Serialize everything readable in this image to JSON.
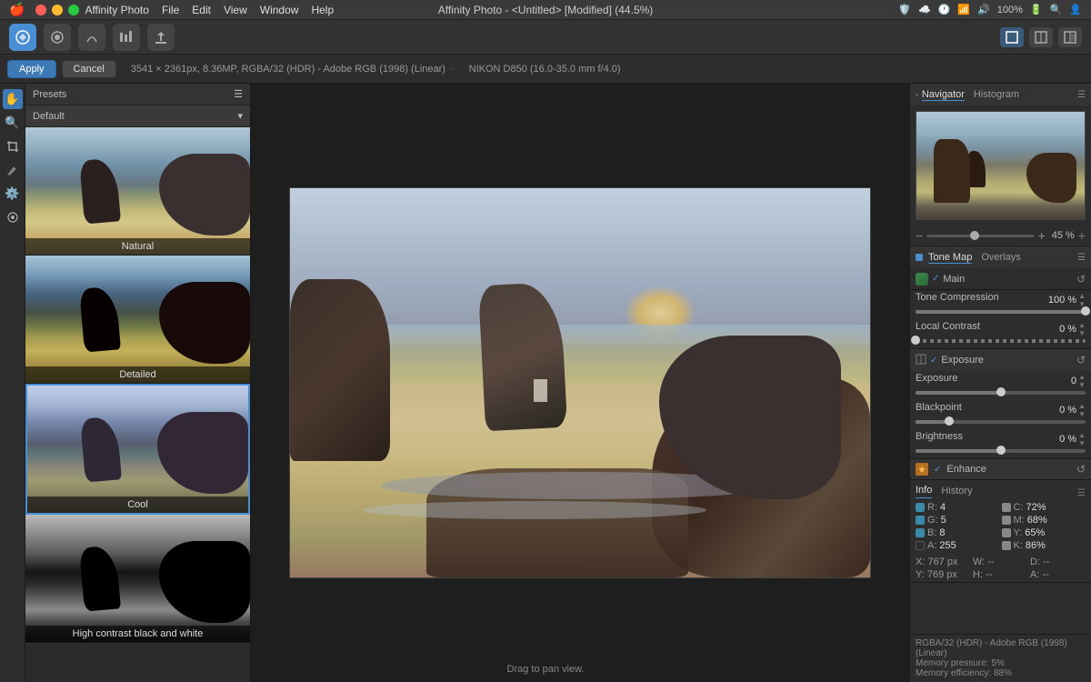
{
  "titleBar": {
    "title": "Affinity Photo - <Untitled> [Modified] (44.5%)",
    "appName": "Affinity Photo",
    "menus": [
      "File",
      "Edit",
      "View",
      "Window",
      "Help"
    ],
    "rightIcons": [
      "🛡️",
      "☁️",
      "🕐",
      "📶",
      "🔊",
      "100%",
      "🔋"
    ],
    "trafficLights": {
      "close": "●",
      "min": "●",
      "max": "●"
    }
  },
  "actionBar": {
    "applyLabel": "Apply",
    "cancelLabel": "Cancel",
    "imageInfo": "3541 × 2361px, 8.36MP, RGBA/32 (HDR) - Adobe RGB (1998) (Linear)",
    "cameraInfo": "NIKON D850 (16.0-35.0 mm f/4.0)"
  },
  "presetsPanel": {
    "title": "Presets",
    "dropdown": "Default",
    "items": [
      {
        "label": "Natural",
        "type": "natural"
      },
      {
        "label": "Detailed",
        "type": "detailed"
      },
      {
        "label": "Cool",
        "type": "cool"
      },
      {
        "label": "High contrast black and white",
        "type": "hcbw"
      }
    ]
  },
  "tools": {
    "items": [
      "✋",
      "🔍",
      "🖊️",
      "🖌️",
      "⚙️"
    ]
  },
  "navigator": {
    "title": "Navigator",
    "histogramTab": "Histogram",
    "zoom": {
      "value": "45 %",
      "minus": "−",
      "plus": "+"
    }
  },
  "toneMap": {
    "title": "Tone Map",
    "overlaysLabel": "Overlays",
    "mainLabel": "Main",
    "toneCompression": {
      "label": "Tone Compression",
      "value": "100 %",
      "fillPct": 100
    },
    "localContrast": {
      "label": "Local Contrast",
      "value": "0 %",
      "fillPct": 0
    }
  },
  "exposure": {
    "title": "Exposure",
    "fields": [
      {
        "label": "Exposure",
        "value": "0",
        "fillPct": 50
      },
      {
        "label": "Blackpoint",
        "value": "0 %",
        "fillPct": 20
      },
      {
        "label": "Brightness",
        "value": "0 %",
        "fillPct": 50
      }
    ]
  },
  "enhance": {
    "title": "Enhance"
  },
  "info": {
    "tabs": [
      "Info",
      "History"
    ],
    "colorValues": {
      "R": {
        "label": "R:",
        "value": "4"
      },
      "G": {
        "label": "G:",
        "value": "5"
      },
      "B": {
        "label": "B:",
        "value": "8"
      },
      "A": {
        "label": "A:",
        "value": "255"
      }
    },
    "rightValues": {
      "C": {
        "label": "C:",
        "value": "72%"
      },
      "M": {
        "label": "M:",
        "value": "68%"
      },
      "Y": {
        "label": "Y:",
        "value": "65%"
      },
      "K": {
        "label": "K:",
        "value": "86%"
      }
    },
    "position": {
      "X": "X: 767 px",
      "Y": "Y: 769 px",
      "W": "W: --",
      "H": "H: --",
      "D": "D: --",
      "A": "A: --"
    },
    "colorMode": "RGBA/32 (HDR) - Adobe RGB (1998) (Linear)",
    "memPressure": "Memory pressure: 5%",
    "memEfficiency": "Memory efficiency: 88%"
  },
  "dragHint": "Drag to pan view.",
  "canvas": {
    "altText": "Landscape photo - coastal scene with rocks at sunset"
  }
}
